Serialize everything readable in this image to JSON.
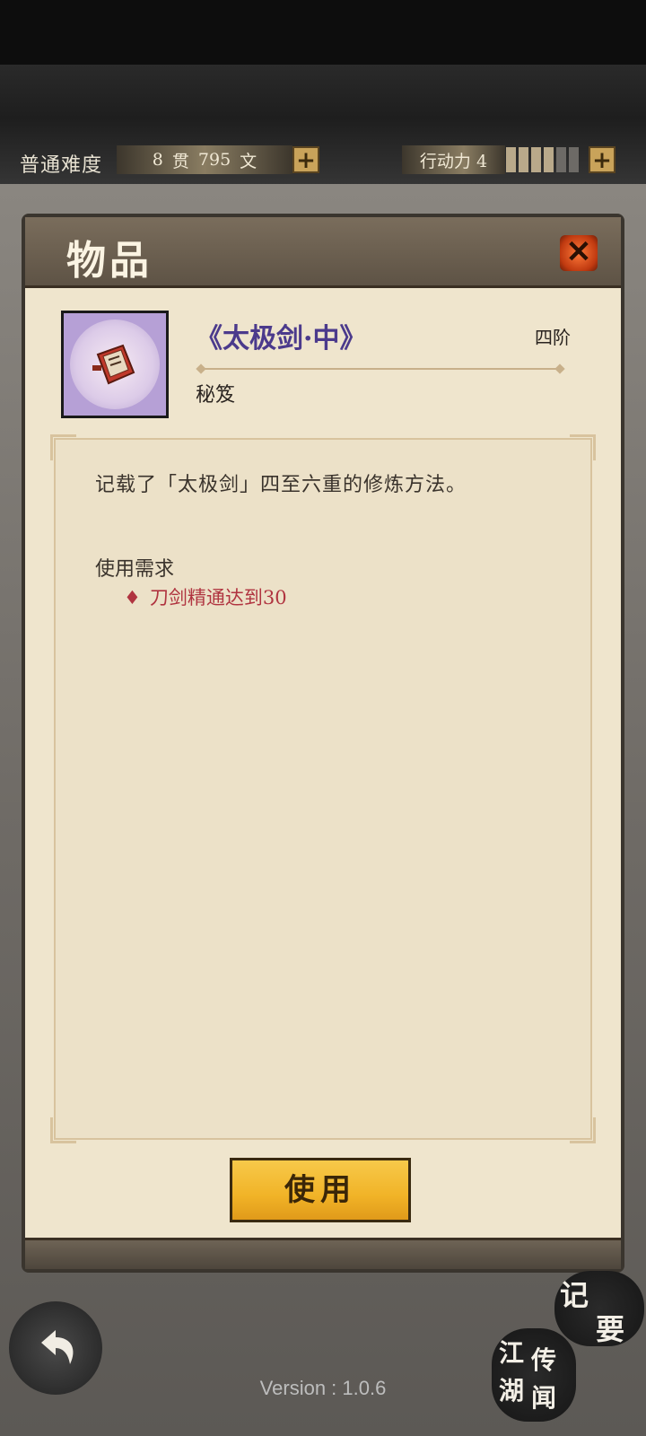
{
  "status_bar": {
    "difficulty": "普通难度",
    "money_guan": "8",
    "money_guan_unit": "贯",
    "money_wen": "795",
    "money_wen_unit": "文",
    "plus": "+",
    "stamina_label": "行动力 4",
    "stamina_level": 4,
    "stamina_max": 6
  },
  "dialog": {
    "title": "物品",
    "close": "✕",
    "item": {
      "name": "《太极剑·中》",
      "tier": "四阶",
      "type": "秘笈",
      "icon": "book-icon"
    },
    "description": "记载了「太极剑」四至六重的修炼方法。",
    "requirements_title": "使用需求",
    "requirements": [
      {
        "text": "刀剑精通达到30"
      }
    ],
    "use_label": "使用"
  },
  "bottom": {
    "notes_label_1": "记",
    "notes_label_2": "要",
    "rumors_label_1": "江",
    "rumors_label_2": "传",
    "rumors_label_3": "湖",
    "rumors_label_4": "闻",
    "version": "Version : 1.0.6"
  },
  "colors": {
    "item_name": "#4b3a8c",
    "requirement": "#b03440",
    "use_button": "#f1b327"
  }
}
